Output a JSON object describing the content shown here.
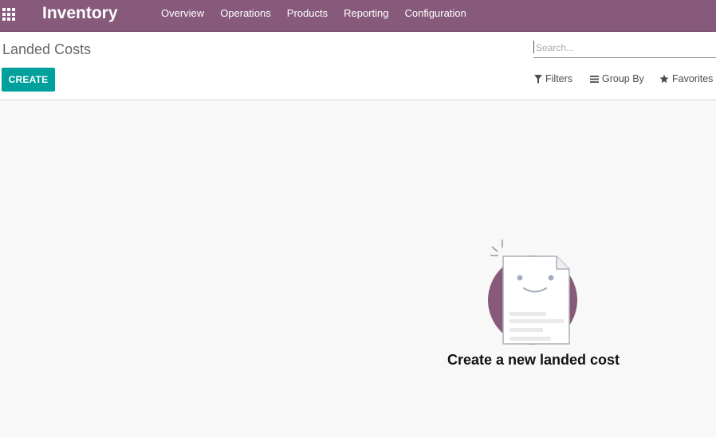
{
  "app": {
    "brand": "Inventory",
    "menu": [
      "Overview",
      "Operations",
      "Products",
      "Reporting",
      "Configuration"
    ]
  },
  "control_panel": {
    "breadcrumb": "Landed Costs",
    "create_label": "CREATE",
    "search_placeholder": "Search...",
    "filters_label": "Filters",
    "group_by_label": "Group By",
    "favorites_label": "Favorites"
  },
  "empty_state": {
    "title": "Create a new landed cost"
  },
  "colors": {
    "navbar": "#875a7b",
    "primary_button": "#00a09d",
    "illustration_circle": "#875a7b"
  }
}
